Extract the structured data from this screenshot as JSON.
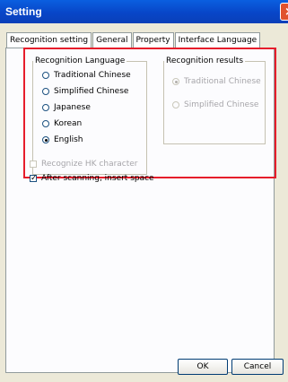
{
  "window": {
    "title": "Setting",
    "close_glyph": "×"
  },
  "tabs": [
    "Recognition setting",
    "General",
    "Property",
    "Interface Language"
  ],
  "recognition_language": {
    "legend": "Recognition Language",
    "options": [
      "Traditional Chinese",
      "Simplified Chinese",
      "Japanese",
      "Korean",
      "English"
    ],
    "selected": "English"
  },
  "recognition_results": {
    "legend": "Recognition results",
    "options": [
      "Traditional Chinese",
      "Simplified Chinese"
    ],
    "selected": "Traditional Chinese"
  },
  "checkboxes": {
    "hk_label": "Recognize HK character",
    "space_label": "After scanning, insert space"
  },
  "buttons": {
    "ok": "OK",
    "cancel": "Cancel"
  },
  "colors": {
    "title_bar": "#0a4fd8",
    "highlight_border": "#e61d2b",
    "dialog_bg": "#ece9d8"
  }
}
